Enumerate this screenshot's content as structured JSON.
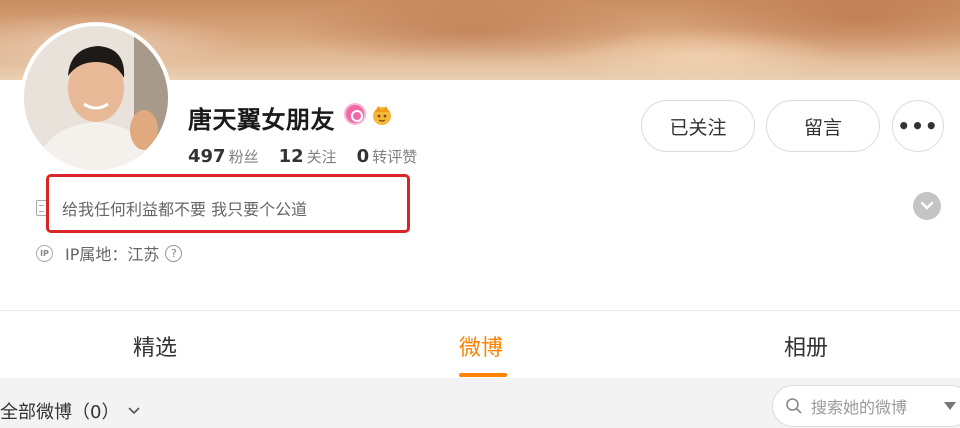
{
  "profile": {
    "name": "唐天翼女朋友",
    "stats": [
      {
        "num": "497",
        "label": "粉丝"
      },
      {
        "num": "12",
        "label": "关注"
      },
      {
        "num": "0",
        "label": "转评赞"
      }
    ],
    "description": "给我任何利益都不要 我只要个公道",
    "ip_location": "IP属地：江苏",
    "ip_icon_text": "IP"
  },
  "actions": {
    "follow_label": "已关注",
    "message_label": "留言",
    "more_label": "•••"
  },
  "tabs": [
    {
      "label": "精选"
    },
    {
      "label": "微博"
    },
    {
      "label": "相册"
    }
  ],
  "filter": {
    "label": "全部微博（0）",
    "search_placeholder": "搜索她的微博"
  },
  "colors": {
    "accent": "#ff8200",
    "highlight_box": "#d92525"
  },
  "icons": [
    "description-icon",
    "ip-icon",
    "help-icon",
    "expand-icon",
    "search-icon",
    "chevron-down-icon",
    "vip-badge-icon",
    "crown-badge-icon"
  ]
}
